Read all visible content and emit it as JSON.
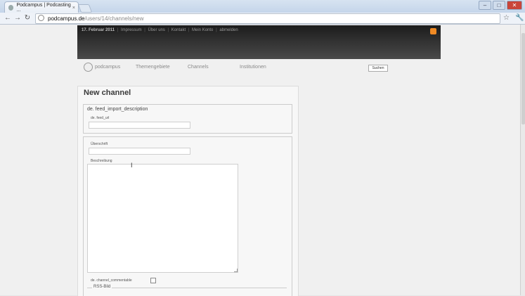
{
  "browser": {
    "tab_title": "Podcampus | Podcasting ...",
    "tab_close": "×",
    "url_host": "podcampus.de",
    "url_path": "/users/14/channels/new",
    "window_buttons": {
      "minimize": "–",
      "maximize": "□",
      "close": "✕"
    },
    "nav_back": "←",
    "nav_forward": "→",
    "nav_reload": "↻",
    "star": "☆",
    "wrench": "🔧"
  },
  "header": {
    "date": "17. Februar 2011",
    "links": [
      "Impressum",
      "Über uns",
      "Kontakt",
      "Mein Konto",
      "abmelden"
    ],
    "separator": "|",
    "rss_color": "#f08a24"
  },
  "nav": {
    "logo_text": "podcampus",
    "items": [
      "Themengebiete",
      "Channels",
      "Institutionen"
    ],
    "search_button": "Suchen"
  },
  "form": {
    "title": "New channel",
    "import_legend": "de. feed_import_description",
    "feed_url_label": "de. feed_url",
    "ueberschrift_label": "Überschrift",
    "beschreibung_label": "Beschreibung",
    "commentable_label": "de. channel_commentable",
    "rss_bild_label": "RSS-Bild"
  }
}
